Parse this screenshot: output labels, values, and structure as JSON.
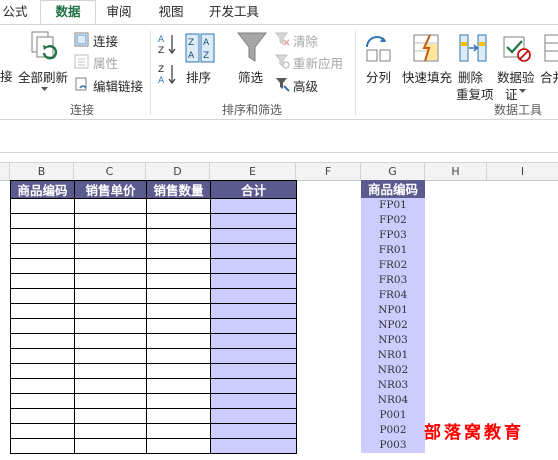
{
  "ribbon_tabs": [
    "公式",
    "数据",
    "审阅",
    "视图",
    "开发工具"
  ],
  "active_tab": "数据",
  "connections_group": {
    "left_cut_label": "接",
    "refresh_all": "全部刷新",
    "connections": "连接",
    "properties": "属性",
    "edit_links": "编辑链接",
    "group_label": "连接"
  },
  "sort_filter_group": {
    "sort": "排序",
    "filter": "筛选",
    "clear": "清除",
    "reapply": "重新应用",
    "advanced": "高级",
    "group_label": "排序和筛选"
  },
  "data_tools_group": {
    "text_to_columns": "分列",
    "flash_fill": "快速填充",
    "remove_duplicates_line1": "删除",
    "remove_duplicates_line2": "重复项",
    "data_validation_line1": "数据验",
    "data_validation_line2": "证",
    "consolidate": "合并",
    "group_label": "数据工具"
  },
  "columns": [
    "B",
    "C",
    "D",
    "E",
    "F",
    "G",
    "H",
    "I"
  ],
  "table_headers": [
    "商品编码",
    "销售单价",
    "销售数量",
    "合计"
  ],
  "g_header": "商品编码",
  "product_codes": [
    "FP01",
    "FP02",
    "FP03",
    "FR01",
    "FR02",
    "FR03",
    "FR04",
    "NP01",
    "NP02",
    "NP03",
    "NR01",
    "NR02",
    "NR03",
    "NR04",
    "P001",
    "P002",
    "P003"
  ],
  "watermark": "部落窝教育",
  "colors": {
    "accent": "#217346",
    "header_bg": "#5b5b8f",
    "sum_fill": "#ccccff",
    "brand": "#ff0000"
  }
}
